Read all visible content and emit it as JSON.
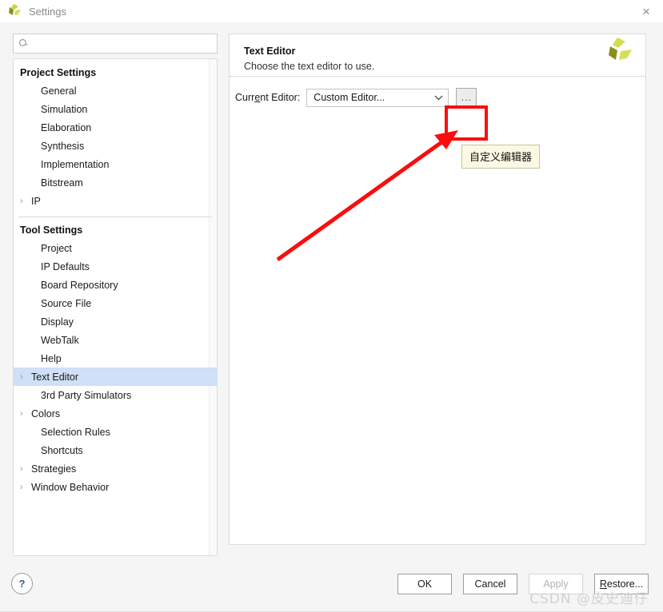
{
  "window": {
    "title": "Settings",
    "logo_icon": "vivado-pinwheel-logo",
    "close_icon": "close-icon",
    "close_label": "×"
  },
  "search": {
    "icon": "search-icon",
    "value": "",
    "placeholder": ""
  },
  "sidebar": {
    "sections": [
      {
        "title": "Project Settings",
        "items": [
          {
            "label": "General",
            "expandable": false,
            "selected": false
          },
          {
            "label": "Simulation",
            "expandable": false,
            "selected": false
          },
          {
            "label": "Elaboration",
            "expandable": false,
            "selected": false
          },
          {
            "label": "Synthesis",
            "expandable": false,
            "selected": false
          },
          {
            "label": "Implementation",
            "expandable": false,
            "selected": false
          },
          {
            "label": "Bitstream",
            "expandable": false,
            "selected": false
          },
          {
            "label": "IP",
            "expandable": true,
            "selected": false
          }
        ]
      },
      {
        "title": "Tool Settings",
        "items": [
          {
            "label": "Project",
            "expandable": false,
            "selected": false
          },
          {
            "label": "IP Defaults",
            "expandable": false,
            "selected": false
          },
          {
            "label": "Board Repository",
            "expandable": false,
            "selected": false
          },
          {
            "label": "Source File",
            "expandable": false,
            "selected": false
          },
          {
            "label": "Display",
            "expandable": false,
            "selected": false
          },
          {
            "label": "WebTalk",
            "expandable": false,
            "selected": false
          },
          {
            "label": "Help",
            "expandable": false,
            "selected": false
          },
          {
            "label": "Text Editor",
            "expandable": true,
            "selected": true
          },
          {
            "label": "3rd Party Simulators",
            "expandable": false,
            "selected": false
          },
          {
            "label": "Colors",
            "expandable": true,
            "selected": false
          },
          {
            "label": "Selection Rules",
            "expandable": false,
            "selected": false
          },
          {
            "label": "Shortcuts",
            "expandable": false,
            "selected": false
          },
          {
            "label": "Strategies",
            "expandable": true,
            "selected": false
          },
          {
            "label": "Window Behavior",
            "expandable": true,
            "selected": false
          }
        ]
      }
    ],
    "chevron_icon": "chevron-right-icon",
    "selection_color": "#cfe0f7"
  },
  "content": {
    "title": "Text Editor",
    "description": "Choose the text editor to use.",
    "logo_icon": "vivado-pinwheel-logo",
    "field_label_prefix": "Curr",
    "field_label_mnemonic": "e",
    "field_label_suffix": "nt Editor:",
    "combo_value": "Custom Editor...",
    "combo_icon": "chevron-down-icon",
    "browse_label": "...",
    "browse_icon": "ellipsis-icon"
  },
  "annotation": {
    "tooltip_text": "自定义编辑器",
    "highlight_color": "#fb0d0d",
    "arrow_icon": "red-arrow-annotation",
    "box_icon": "red-highlight-box"
  },
  "footer": {
    "help_label": "?",
    "help_icon": "help-icon",
    "buttons": [
      {
        "label": "OK",
        "disabled": false,
        "mnemonic": ""
      },
      {
        "label": "Cancel",
        "disabled": false,
        "mnemonic": ""
      },
      {
        "label": "Apply",
        "disabled": true,
        "mnemonic": ""
      },
      {
        "label": "Restore...",
        "disabled": false,
        "mnemonic": "R"
      }
    ],
    "ok_label": "OK",
    "cancel_label": "Cancel",
    "apply_label": "Apply",
    "restore_mnemonic": "R",
    "restore_rest": "estore...",
    "watermark": "CSDN @皮史迪仔"
  }
}
